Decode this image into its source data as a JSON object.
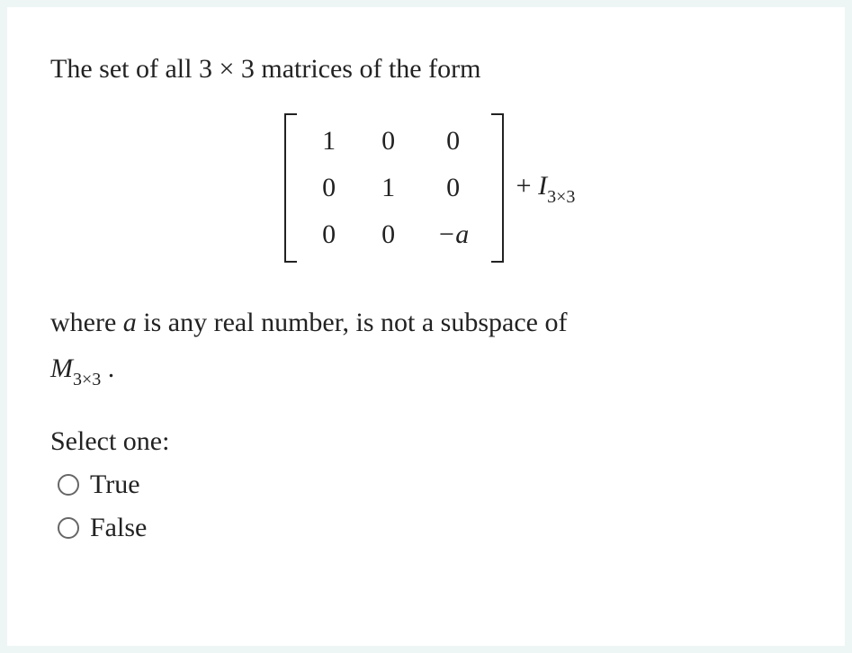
{
  "question": {
    "line1": "The set of all 3 × 3 matrices of the form",
    "matrix": {
      "r1c1": "1",
      "r1c2": "0",
      "r1c3": "0",
      "r2c1": "0",
      "r2c2": "1",
      "r2c3": "0",
      "r3c1": "0",
      "r3c2": "0",
      "r3c3": "−a"
    },
    "plus": "+ ",
    "identity_I": "I",
    "identity_sub": "3×3",
    "line2_pre": "where ",
    "line2_var": "a",
    "line2_post": " is any real number, is not a subspace of",
    "line3_M": "M",
    "line3_sub": "3×3",
    "line3_end": " ."
  },
  "prompt": "Select one:",
  "options": {
    "true": "True",
    "false": "False"
  }
}
